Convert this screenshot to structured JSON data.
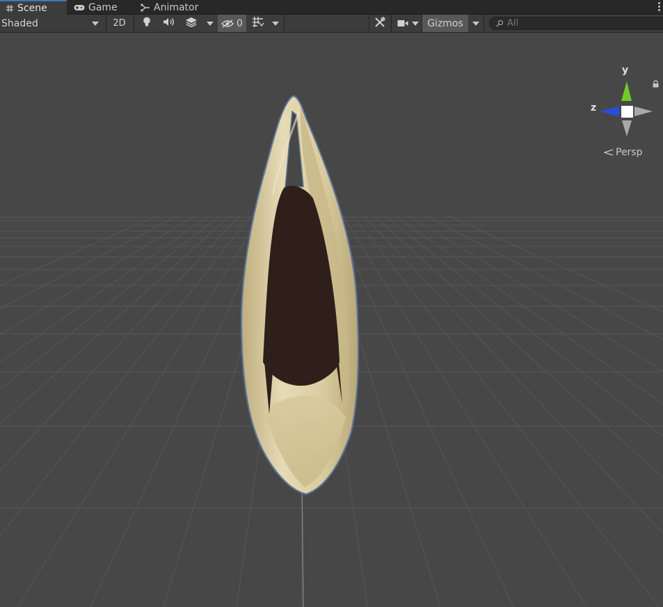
{
  "tabs": [
    {
      "label": "Scene",
      "icon": "grid-icon",
      "active": true
    },
    {
      "label": "Game",
      "icon": "gamepad-icon",
      "active": false
    },
    {
      "label": "Animator",
      "icon": "animator-icon",
      "active": false
    }
  ],
  "toolbar": {
    "draw_mode": "Shaded",
    "mode_2d": "2D",
    "hidden_count": "0",
    "gizmos_label": "Gizmos",
    "search_placeholder": "All"
  },
  "gizmo": {
    "y_label": "y",
    "z_label": "z",
    "projection": "Persp"
  },
  "colors": {
    "accent": "#3a79bb",
    "background": "#474747",
    "axis_y": "#6dcc29",
    "axis_z": "#2a4de0",
    "model_shell": "#dccfa6",
    "model_cavity": "#2f1f1a"
  }
}
